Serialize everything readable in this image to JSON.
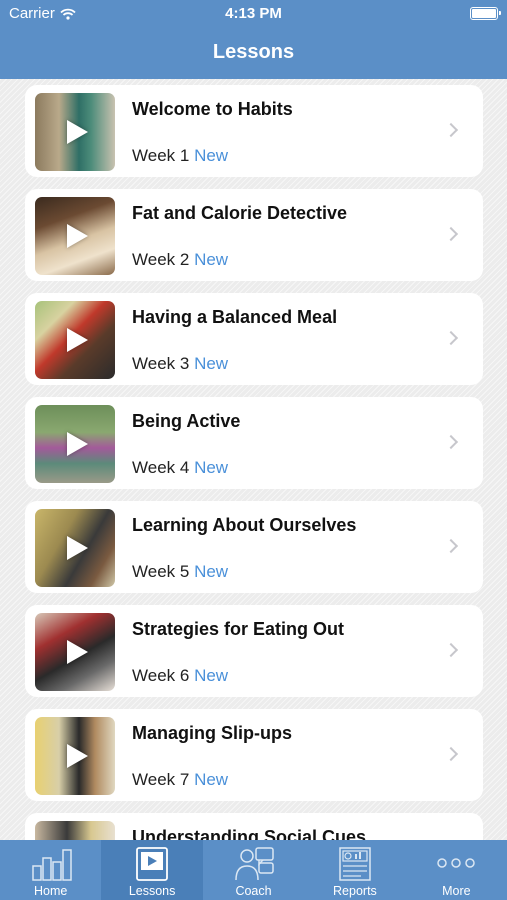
{
  "status_bar": {
    "carrier": "Carrier",
    "time": "4:13 PM"
  },
  "nav": {
    "title": "Lessons"
  },
  "lessons": [
    {
      "title": "Welcome to Habits",
      "week": "Week 1",
      "badge": "New"
    },
    {
      "title": "Fat and Calorie Detective",
      "week": "Week 2",
      "badge": "New"
    },
    {
      "title": "Having a Balanced Meal",
      "week": "Week 3",
      "badge": "New"
    },
    {
      "title": "Being Active",
      "week": "Week 4",
      "badge": "New"
    },
    {
      "title": "Learning About Ourselves",
      "week": "Week 5",
      "badge": "New"
    },
    {
      "title": "Strategies for Eating Out",
      "week": "Week 6",
      "badge": "New"
    },
    {
      "title": "Managing Slip-ups",
      "week": "Week 7",
      "badge": "New"
    },
    {
      "title": "Understanding Social Cues",
      "week": "",
      "badge": ""
    }
  ],
  "tabs": [
    {
      "label": "Home",
      "icon": "bar-chart-icon"
    },
    {
      "label": "Lessons",
      "icon": "video-icon"
    },
    {
      "label": "Coach",
      "icon": "coach-chat-icon"
    },
    {
      "label": "Reports",
      "icon": "report-icon"
    },
    {
      "label": "More",
      "icon": "more-icon"
    }
  ],
  "colors": {
    "nav": "#5b8fc7",
    "tab_active": "#4a7fb8",
    "accent_new": "#4a90d9"
  }
}
